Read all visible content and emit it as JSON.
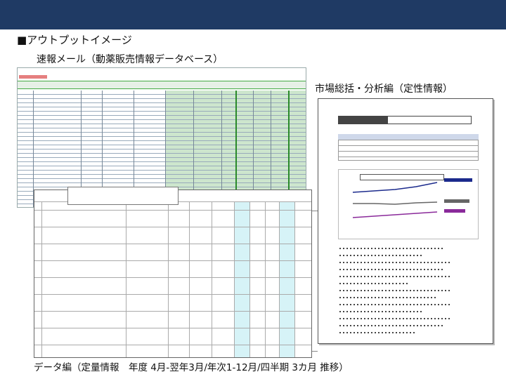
{
  "page": {
    "heading": "■アウトプットイメージ",
    "left_caption": "速報メール（動薬販売情報データベース）",
    "right_caption": "市場総括・分析編（定性情報）",
    "bottom_caption": "データ編（定量情報　年度 4月-翌年3月/年次1-12月/四半期 3カ月 推移）"
  },
  "colors": {
    "top_bar": "#1f3a64",
    "sheet_green": "#cde6cd",
    "highlight_cyan": "#d6f3f7"
  }
}
